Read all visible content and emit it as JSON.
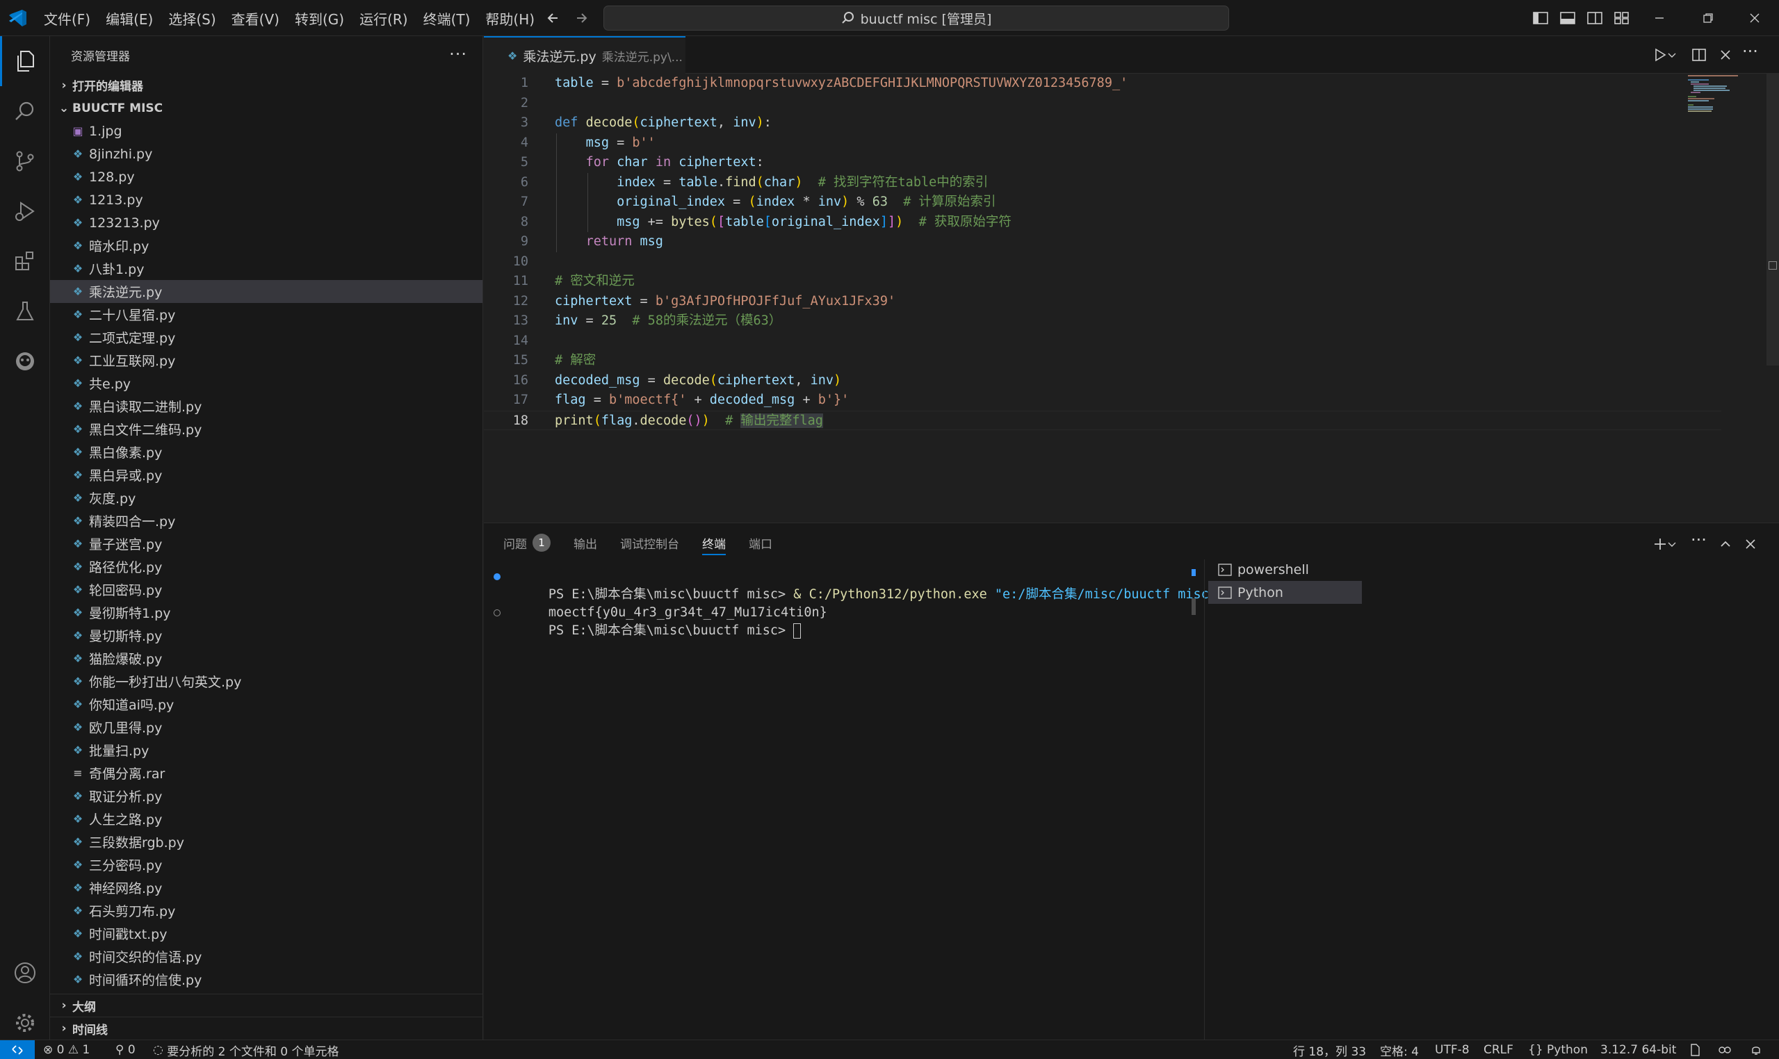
{
  "titlebar": {
    "menu": [
      "文件(F)",
      "编辑(E)",
      "选择(S)",
      "查看(V)",
      "转到(G)",
      "运行(R)",
      "终端(T)",
      "帮助(H)"
    ],
    "command_center": "buuctf misc [管理员]"
  },
  "sidebar": {
    "title": "资源管理器",
    "open_editors": "打开的编辑器",
    "folder": "BUUCTF MISC",
    "files": [
      {
        "name": "1.jpg",
        "type": "image"
      },
      {
        "name": "8jinzhi.py",
        "type": "python"
      },
      {
        "name": "128.py",
        "type": "python"
      },
      {
        "name": "1213.py",
        "type": "python"
      },
      {
        "name": "123213.py",
        "type": "python"
      },
      {
        "name": "暗水印.py",
        "type": "python"
      },
      {
        "name": "八卦1.py",
        "type": "python"
      },
      {
        "name": "乘法逆元.py",
        "type": "python",
        "active": true
      },
      {
        "name": "二十八星宿.py",
        "type": "python"
      },
      {
        "name": "二项式定理.py",
        "type": "python"
      },
      {
        "name": "工业互联网.py",
        "type": "python"
      },
      {
        "name": "共e.py",
        "type": "python"
      },
      {
        "name": "黑白读取二进制.py",
        "type": "python"
      },
      {
        "name": "黑白文件二维码.py",
        "type": "python"
      },
      {
        "name": "黑白像素.py",
        "type": "python"
      },
      {
        "name": "黑白异或.py",
        "type": "python"
      },
      {
        "name": "灰度.py",
        "type": "python"
      },
      {
        "name": "精装四合一.py",
        "type": "python"
      },
      {
        "name": "量子迷宫.py",
        "type": "python"
      },
      {
        "name": "路径优化.py",
        "type": "python"
      },
      {
        "name": "轮回密码.py",
        "type": "python"
      },
      {
        "name": "曼彻斯特1.py",
        "type": "python"
      },
      {
        "name": "曼切斯特.py",
        "type": "python"
      },
      {
        "name": "猫脸爆破.py",
        "type": "python"
      },
      {
        "name": "你能一秒打出八句英文.py",
        "type": "python"
      },
      {
        "name": "你知道ai吗.py",
        "type": "python"
      },
      {
        "name": "欧几里得.py",
        "type": "python"
      },
      {
        "name": "批量扫.py",
        "type": "python"
      },
      {
        "name": "奇偶分离.rar",
        "type": "rar"
      },
      {
        "name": "取证分析.py",
        "type": "python"
      },
      {
        "name": "人生之路.py",
        "type": "python"
      },
      {
        "name": "三段数据rgb.py",
        "type": "python"
      },
      {
        "name": "三分密码.py",
        "type": "python"
      },
      {
        "name": "神经网络.py",
        "type": "python"
      },
      {
        "name": "石头剪刀布.py",
        "type": "python"
      },
      {
        "name": "时间戳txt.py",
        "type": "python"
      },
      {
        "name": "时间交织的信语.py",
        "type": "python"
      },
      {
        "name": "时间循环的信使.py",
        "type": "python"
      }
    ],
    "outline": "大纲",
    "timeline": "时间线"
  },
  "editor": {
    "tab_name": "乘法逆元.py",
    "tab_desc": "乘法逆元.py\\...",
    "line_numbers": [
      "1",
      "2",
      "3",
      "4",
      "5",
      "6",
      "7",
      "8",
      "9",
      "10",
      "11",
      "12",
      "13",
      "14",
      "15",
      "16",
      "17",
      "18"
    ],
    "code_lines": [
      "table = b'abcdefghijklmnopqrstuvwxyzABCDEFGHIJKLMNOPQRSTUVWXYZ0123456789_'",
      "",
      "def decode(ciphertext, inv):",
      "    msg = b''",
      "    for char in ciphertext:",
      "        index = table.find(char)  # 找到字符在table中的索引",
      "        original_index = (index * inv) % 63  # 计算原始索引",
      "        msg += bytes([table[original_index]])  # 获取原始字符",
      "    return msg",
      "",
      "# 密文和逆元",
      "ciphertext = b'g3AfJPOfHPOJFfJuf_AYux1JFx39'",
      "inv = 25  # 58的乘法逆元（模63）",
      "",
      "# 解密",
      "decoded_msg = decode(ciphertext, inv)",
      "flag = b'moectf{' + decoded_msg + b'}'",
      "print(flag.decode())  # 输出完整flag"
    ],
    "current_line": 18
  },
  "panel": {
    "tabs": [
      "问题",
      "输出",
      "调试控制台",
      "终端",
      "端口"
    ],
    "problems_count": "1",
    "active_tab": "终端",
    "terminal": {
      "prompt1": "PS E:\\脚本合集\\misc\\buuctf misc> ",
      "cmd_amp": "& ",
      "cmd_exe": "C:/Python312/python.exe",
      "cmd_arg": " \"e:/脚本合集/misc/buuctf misc/乘法逆元.py\"",
      "output": "moectf{y0u_4r3_gr34t_47_Mu17ic4ti0n}",
      "prompt2": "PS E:\\脚本合集\\misc\\buuctf misc> "
    },
    "terminal_list": [
      "powershell",
      "Python"
    ]
  },
  "statusbar": {
    "errors": "0",
    "warnings": "1",
    "ports": "0",
    "analysis": "要分析的 2 个文件和 0 个单元格",
    "position": "行 18，列 33",
    "spaces": "空格: 4",
    "encoding": "UTF-8",
    "eol": "CRLF",
    "language": "{} Python",
    "interpreter": "3.12.7 64-bit"
  },
  "colors": {
    "accent": "#0078d4",
    "python_icon": "#519aba",
    "keyword": "#c586c0",
    "string": "#ce9178",
    "comment": "#6a9955"
  }
}
